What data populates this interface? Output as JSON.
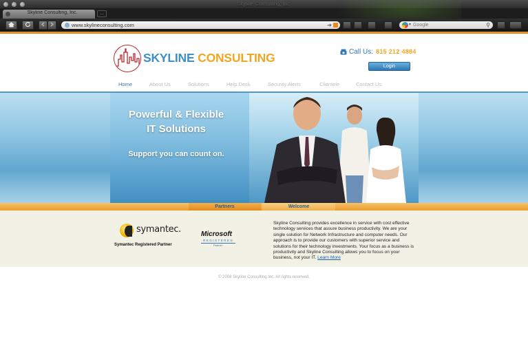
{
  "browser": {
    "window_title": "Skyline Consulting, Inc.",
    "tab_title": "Skyline Consulting, Inc.",
    "new_tab_label": "...",
    "url": "www.skylineconsulting.com",
    "search_placeholder": "Google",
    "go_glyph": "➔",
    "search_glyph": "⚲"
  },
  "header": {
    "logo_part1": "SKYLINE",
    "logo_part2": "CONSULTING",
    "call_label": "Call Us:",
    "phone": "815 212 4884",
    "login_label": "Login"
  },
  "nav": {
    "items": [
      {
        "label": "Home",
        "active": true
      },
      {
        "label": "About Us"
      },
      {
        "label": "Solutions"
      },
      {
        "label": "Help Desk"
      },
      {
        "label": "Security Alerts"
      },
      {
        "label": "Clientele"
      },
      {
        "label": "Contact Us"
      }
    ]
  },
  "hero": {
    "headline_line1": "Powerful & Flexible",
    "headline_line2": "IT Solutions",
    "tagline": "Support you can count on."
  },
  "sections": {
    "partners_tab": "Partners",
    "welcome_tab": "Welcome"
  },
  "partners": {
    "symantec_word": "symantec.",
    "symantec_caption": "Symantec Registered Partner",
    "microsoft_word": "Microsoft",
    "microsoft_registered": "REGISTERED",
    "microsoft_partner": "Partner"
  },
  "welcome": {
    "body": "Skyline Consulting provides excellence in service with cost effective technology services that assure business productivity. We are your single solution for Network Infrastructure and computer needs. Our approach is to provide our customers with superior service and solutions for their technology investments. Your focus as a business is productivity and Skyline Consulting allows you to focus on your business, not your IT.",
    "learn_more": "Learn More"
  },
  "footer": {
    "copyright": "© 2008 Skyline Consulting Inc. All rights reserved."
  },
  "colors": {
    "brand_blue": "#3d8fc8",
    "brand_orange": "#f0a622",
    "nav_active": "#2f78b4"
  }
}
